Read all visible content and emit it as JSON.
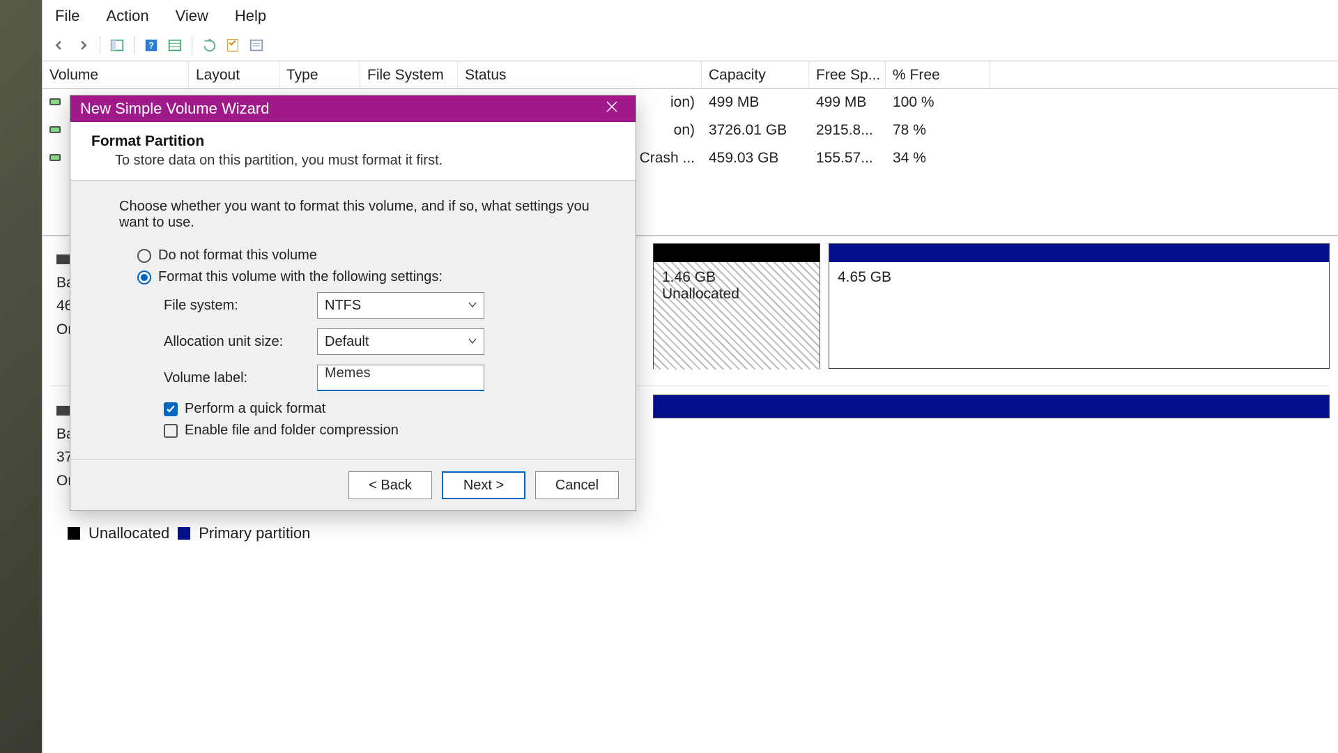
{
  "menubar": {
    "file": "File",
    "action": "Action",
    "view": "View",
    "help": "Help"
  },
  "columns": {
    "volume": "Volume",
    "layout": "Layout",
    "type": "Type",
    "filesystem": "File System",
    "status": "Status",
    "capacity": "Capacity",
    "freesp": "Free Sp...",
    "pctfree": "% Free"
  },
  "rows": {
    "r0": {
      "status_tail": "ion)",
      "capacity": "499 MB",
      "free": "499 MB",
      "pct": "100 %"
    },
    "r1": {
      "status_tail": "on)",
      "capacity": "3726.01 GB",
      "free": "2915.8...",
      "pct": "78 %"
    },
    "r2": {
      "status_tail": "Crash ...",
      "capacity": "459.03 GB",
      "free": "155.57...",
      "pct": "34 %"
    }
  },
  "disk0": {
    "label_line1": "Ba",
    "label_line2": "46",
    "label_line3": "Or"
  },
  "disk1": {
    "label_line1": "Ba",
    "label_line2": "37",
    "label_line3": "Or"
  },
  "part_unalloc": {
    "size": "1.46 GB",
    "label": "Unallocated"
  },
  "part_other": {
    "size": "4.65 GB"
  },
  "legend": {
    "unalloc": "Unallocated",
    "primary": "Primary partition"
  },
  "dialog": {
    "title": "New Simple Volume Wizard",
    "heading": "Format Partition",
    "subheading": "To store data on this partition, you must format it first.",
    "lead": "Choose whether you want to format this volume, and if so, what settings you want to use.",
    "opt_noformat": "Do not format this volume",
    "opt_format": "Format this volume with the following settings:",
    "lbl_fs": "File system:",
    "val_fs": "NTFS",
    "lbl_alloc": "Allocation unit size:",
    "val_alloc": "Default",
    "lbl_label": "Volume label:",
    "val_label": "Memes",
    "chk_quick": "Perform a quick format",
    "chk_compress": "Enable file and folder compression",
    "btn_back": "< Back",
    "btn_next": "Next >",
    "btn_cancel": "Cancel"
  }
}
